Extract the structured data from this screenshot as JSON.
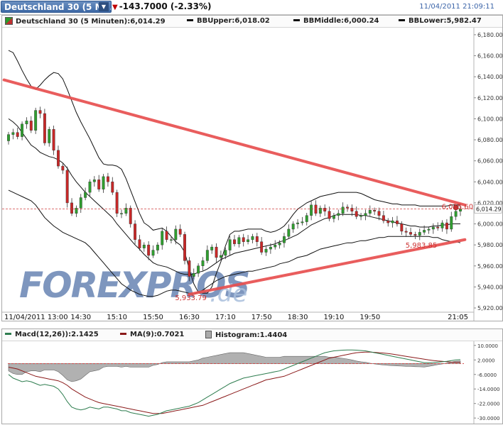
{
  "header": {
    "instrument_tab": "Deutschland 30 (5 Mi...",
    "change": "-143.7000 (-2.33%)",
    "datetime": "11/04/2011 21:09:11"
  },
  "main_legend": {
    "instrument": "Deutschland 30 (5 Minuten):6,014.29",
    "bb_upper": "BBUpper:6,018.02",
    "bb_middle": "BBMiddle:6,000.24",
    "bb_lower": "BBLower:5,982.47"
  },
  "indicator_legend": {
    "macd": "Macd(12,26)):2.1425",
    "ma": "MA(9):0.7021",
    "histogram": "Histogram:1.4404"
  },
  "watermark": {
    "brand": "FOREXPROS",
    "suffix": ".de"
  },
  "colors": {
    "candle_up": "#2f9e2f",
    "candle_down": "#c82828",
    "trendline": "#e85050",
    "band": "#111111",
    "macd_line": "#2e7d4f",
    "ma_line": "#8b1a1a",
    "histogram_fill": "#a9a9a9",
    "watermark_blue": "#4d6fa6",
    "watermark_light": "#a9bfdc",
    "price_label": "#cc3333"
  },
  "chart_data": [
    {
      "type": "candlestick",
      "x_tick_labels": [
        "11/04/2011 13:00",
        "14:30",
        "15:10",
        "15:50",
        "16:30",
        "17:10",
        "17:50",
        "18:30",
        "19:10",
        "19:50",
        "21:05"
      ],
      "y_tick_labels": [
        "6,180.00",
        "6,160.00",
        "6,140.00",
        "6,120.00",
        "6,100.00",
        "6,080.00",
        "6,060.00",
        "6,040.00",
        "6,020.00",
        "6,000.00",
        "5,980.00",
        "5,960.00",
        "5,940.00",
        "5,920.00"
      ],
      "ylim": [
        5918,
        6184
      ],
      "last_price_label": "6,014.29",
      "annotations": [
        {
          "label": "6,015.60",
          "bar": 99,
          "value": 6017
        },
        {
          "label": "5,983.85",
          "bar": 91,
          "value": 5980
        },
        {
          "label": "5,933.79",
          "bar": 40,
          "value": 5930
        }
      ],
      "last_price": 6014.29,
      "close": [
        6085,
        6087,
        6083,
        6095,
        6098,
        6089,
        6108,
        6105,
        6077,
        6090,
        6070,
        6055,
        6051,
        6020,
        6010,
        6015,
        6025,
        6030,
        6040,
        6042,
        6033,
        6045,
        6040,
        6030,
        6010,
        6010,
        6015,
        6000,
        5985,
        5977,
        5980,
        5970,
        5975,
        5980,
        5993,
        5985,
        5985,
        5995,
        5990,
        5965,
        5950,
        5953,
        5960,
        5965,
        5975,
        5978,
        5968,
        5970,
        5975,
        5985,
        5981,
        5987,
        5983,
        5985,
        5988,
        5983,
        5973,
        5976,
        5978,
        5980,
        5982,
        5988,
        5995,
        6000,
        6001,
        6002,
        6008,
        6018,
        6010,
        6015,
        6012,
        6005,
        6008,
        6010,
        6016,
        6015,
        6012,
        6007,
        6008,
        6010,
        6013,
        6012,
        6008,
        6003,
        6001,
        6003,
        6000,
        5993,
        5992,
        5990,
        5989,
        5992,
        5994,
        5995,
        5997,
        5996,
        6001,
        5995,
        6007,
        6012,
        6014
      ],
      "bb_upper": [
        6165,
        6163,
        6155,
        6146,
        6138,
        6131,
        6128,
        6132,
        6137,
        6141,
        6144,
        6143,
        6138,
        6128,
        6117,
        6106,
        6097,
        6089,
        6081,
        6072,
        6063,
        6057,
        6056,
        6056,
        6055,
        6052,
        6043,
        6032,
        6021,
        6010,
        6001,
        5998,
        5994,
        5995,
        5996,
        5993,
        5988,
        5983,
        5980,
        5973,
        5957,
        5943,
        5935,
        5934,
        5934,
        5940,
        5953,
        5964,
        5979,
        5990,
        5993,
        5993,
        5994,
        5995,
        5995,
        5995,
        5995,
        5993,
        5992,
        5993,
        5995,
        5998,
        6003,
        6009,
        6014,
        6017,
        6020,
        6022,
        6024,
        6026,
        6027,
        6028,
        6029,
        6030,
        6030,
        6030,
        6030,
        6030,
        6029,
        6027,
        6025,
        6023,
        6022,
        6021,
        6020,
        6019,
        6019,
        6018,
        6018,
        6018,
        6018,
        6017,
        6017,
        6017,
        6017,
        6017,
        6017,
        6017,
        6018,
        6018,
        6018
      ],
      "bb_middle": [
        6100,
        6097,
        6093,
        6087,
        6081,
        6075,
        6072,
        6068,
        6066,
        6064,
        6063,
        6061,
        6058,
        6053,
        6046,
        6040,
        6035,
        6030,
        6026,
        6022,
        6018,
        6014,
        6010,
        6006,
        6000,
        5995,
        5990,
        5985,
        5980,
        5976,
        5971,
        5967,
        5963,
        5961,
        5960,
        5959,
        5957,
        5955,
        5953,
        5952,
        5952,
        5952,
        5954,
        5955,
        5957,
        5960,
        5963,
        5966,
        5968,
        5970,
        5972,
        5973,
        5974,
        5975,
        5976,
        5977,
        5978,
        5979,
        5980,
        5981,
        5983,
        5984,
        5986,
        5988,
        5990,
        5993,
        5996,
        5999,
        6001,
        6003,
        6005,
        6006,
        6008,
        6009,
        6009,
        6009,
        6009,
        6009,
        6008,
        6008,
        6007,
        6006,
        6005,
        6004,
        6003,
        6002,
        6001,
        6000,
        5999,
        5998,
        5998,
        5997,
        5997,
        5997,
        5998,
        5998,
        5999,
        5999,
        6000,
        6000,
        6000
      ],
      "bb_lower": [
        6032,
        6030,
        6028,
        6026,
        6024,
        6022,
        6018,
        6012,
        6006,
        6002,
        5998,
        5995,
        5992,
        5990,
        5988,
        5986,
        5984,
        5982,
        5978,
        5973,
        5968,
        5963,
        5958,
        5953,
        5948,
        5943,
        5940,
        5937,
        5935,
        5933,
        5932,
        5931,
        5931,
        5932,
        5934,
        5936,
        5937,
        5937,
        5936,
        5935,
        5934,
        5933,
        5935,
        5937,
        5940,
        5943,
        5946,
        5948,
        5950,
        5951,
        5952,
        5953,
        5954,
        5955,
        5955,
        5956,
        5957,
        5958,
        5959,
        5960,
        5962,
        5963,
        5964,
        5966,
        5968,
        5969,
        5970,
        5972,
        5974,
        5976,
        5977,
        5978,
        5979,
        5980,
        5981,
        5982,
        5982,
        5983,
        5984,
        5984,
        5985,
        5986,
        5987,
        5987,
        5988,
        5988,
        5988,
        5988,
        5988,
        5988,
        5988,
        5988,
        5988,
        5988,
        5987,
        5987,
        5985,
        5984,
        5983,
        5983,
        5982
      ],
      "trendlines": [
        {
          "from": [
            -1,
            6137
          ],
          "to": [
            101,
            6018
          ]
        },
        {
          "from": [
            40,
            5933
          ],
          "to": [
            101,
            5985
          ]
        }
      ]
    },
    {
      "type": "line",
      "series_labels": [
        "Macd(12,26))",
        "MA(9)",
        "Histogram"
      ],
      "y_tick_labels": [
        "10.0000",
        "2.0000",
        "-6.0000",
        "-14.0000",
        "-22.0000",
        "-30.0000"
      ],
      "ylim": [
        -31.5,
        11.5
      ],
      "zero_line": 0,
      "macd": [
        -6,
        -8,
        -9,
        -10,
        -9.5,
        -10,
        -11,
        -12,
        -11.5,
        -12,
        -12.5,
        -14,
        -17,
        -21,
        -24,
        -25,
        -25.5,
        -25,
        -24,
        -24.5,
        -25,
        -24,
        -24,
        -24.5,
        -25,
        -26,
        -26,
        -27,
        -27.5,
        -28,
        -28.5,
        -29,
        -28.5,
        -28,
        -27,
        -26,
        -25.5,
        -25,
        -24.5,
        -24,
        -23.5,
        -22.5,
        -21.5,
        -20,
        -18.5,
        -17,
        -15.5,
        -14,
        -12.5,
        -11,
        -10,
        -9,
        -8,
        -7.5,
        -7,
        -6.5,
        -6,
        -5.5,
        -5,
        -4.5,
        -4,
        -3,
        -2,
        -1,
        0,
        1,
        2,
        3,
        4,
        5,
        6,
        6.5,
        7,
        7.2,
        7.4,
        7.5,
        7.5,
        7.4,
        7.2,
        7,
        6.5,
        6,
        5.5,
        5,
        4.5,
        4,
        3.5,
        3,
        2.5,
        2,
        1.5,
        1,
        0.5,
        0.5,
        0.6,
        0.8,
        1,
        1.2,
        1.6,
        2,
        2.1425
      ],
      "ma": [
        -2,
        -2.5,
        -3,
        -4,
        -5,
        -6,
        -7,
        -7.5,
        -8,
        -8.5,
        -9,
        -9.5,
        -10.5,
        -12,
        -14,
        -15.5,
        -17,
        -18.5,
        -19.5,
        -20.5,
        -21.5,
        -22,
        -22.5,
        -23,
        -23.5,
        -24,
        -24.5,
        -25,
        -25.5,
        -26,
        -26.5,
        -27,
        -27.5,
        -27.5,
        -27.5,
        -27,
        -26.5,
        -26,
        -25.5,
        -25,
        -24.5,
        -24,
        -23.5,
        -23,
        -22,
        -21,
        -20,
        -19,
        -18,
        -17,
        -16,
        -15,
        -14,
        -13,
        -12,
        -11,
        -10,
        -9,
        -8.5,
        -8,
        -7.5,
        -7,
        -6,
        -5,
        -4,
        -3,
        -2,
        -1,
        0,
        1,
        2,
        3,
        3.5,
        4,
        4.5,
        5,
        5.5,
        6,
        6.2,
        6.3,
        6.3,
        6.2,
        6,
        5.8,
        5.5,
        5.2,
        4.8,
        4.4,
        4,
        3.6,
        3.2,
        2.8,
        2.4,
        2,
        1.7,
        1.4,
        1.2,
        1,
        0.8,
        0.7,
        0.7021
      ],
      "histogram_sign": [
        -4,
        -5.5,
        -6,
        -6,
        -4.5,
        -4,
        -4,
        -4.5,
        -3.5,
        -3.5,
        -3.5,
        -4.5,
        -6.5,
        -9,
        -10,
        -9.5,
        -8.5,
        -6.5,
        -4.5,
        -4,
        -3.5,
        -2,
        -1.5,
        -1.5,
        -1.5,
        -2,
        -1.5,
        -2,
        -2,
        -2,
        -2,
        -2,
        -1,
        -0.5,
        0.5,
        1,
        1,
        1,
        1,
        1,
        1,
        1.5,
        2,
        3,
        3.5,
        4,
        4.5,
        5,
        5.5,
        6,
        6,
        6,
        6,
        5.5,
        5,
        4.5,
        4,
        3.5,
        3.5,
        3.5,
        3.5,
        4,
        4,
        4,
        4,
        4,
        4,
        4,
        4,
        4,
        4,
        3.5,
        3.5,
        3.2,
        2.9,
        2.5,
        2,
        1.4,
        1,
        0.7,
        0.2,
        -0.2,
        -0.5,
        -0.8,
        -1,
        -1.2,
        -1.3,
        -1.4,
        -1.5,
        -1.6,
        -1.7,
        -1.8,
        -1.9,
        -1.5,
        -1.1,
        -0.6,
        -0.2,
        0.2,
        0.8,
        1.3,
        1.4404
      ]
    }
  ]
}
